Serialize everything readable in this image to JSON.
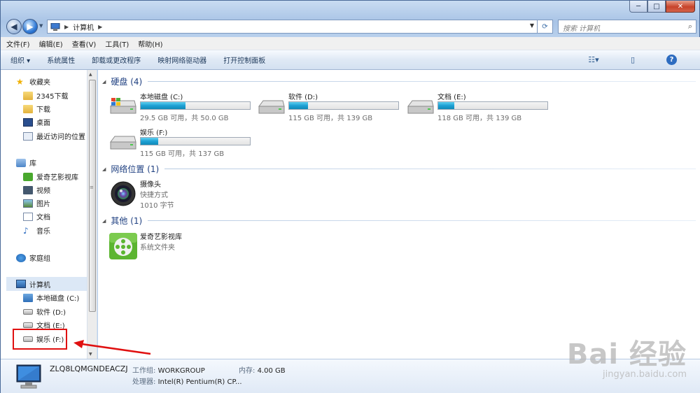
{
  "window": {
    "min_label": "─",
    "max_label": "□",
    "close_label": "✕"
  },
  "address": {
    "location": "计算机",
    "search_placeholder": "搜索 计算机"
  },
  "menu": [
    "文件(F)",
    "编辑(E)",
    "查看(V)",
    "工具(T)",
    "帮助(H)"
  ],
  "toolbar": {
    "organize": "组织 ▾",
    "system_properties": "系统属性",
    "uninstall": "卸载或更改程序",
    "map_drive": "映射网络驱动器",
    "control_panel": "打开控制面板"
  },
  "sidebar": {
    "favorites": "收藏夹",
    "fav_items": [
      "2345下载",
      "下载",
      "桌面",
      "最近访问的位置"
    ],
    "libraries": "库",
    "lib_items": [
      "爱奇艺影视库",
      "视频",
      "图片",
      "文档",
      "音乐"
    ],
    "homegroup": "家庭组",
    "computer": "计算机",
    "drives": [
      "本地磁盘 (C:)",
      "软件 (D:)",
      "文档 (E:)",
      "娱乐 (F:)"
    ]
  },
  "groups": {
    "hdd": "硬盘 (4)",
    "network": "网络位置 (1)",
    "other": "其他 (1)"
  },
  "drives": [
    {
      "name": "本地磁盘 (C:)",
      "status": "29.5 GB 可用，共 50.0 GB",
      "used_fraction": 0.41
    },
    {
      "name": "软件 (D:)",
      "status": "115 GB 可用，共 139 GB",
      "used_fraction": 0.17
    },
    {
      "name": "文档 (E:)",
      "status": "118 GB 可用，共 139 GB",
      "used_fraction": 0.15
    },
    {
      "name": "娱乐 (F:)",
      "status": "115 GB 可用，共 137 GB",
      "used_fraction": 0.16
    }
  ],
  "network_item": {
    "name": "摄像头",
    "type": "快捷方式",
    "size": "1010 字节"
  },
  "other_item": {
    "name": "爱奇艺影视库",
    "type": "系统文件夹"
  },
  "details": {
    "computer_name": "ZLQ8LQMGNDEACZJ",
    "workgroup_label": "工作组:",
    "workgroup": "WORKGROUP",
    "memory_label": "内存:",
    "memory": "4.00 GB",
    "cpu_label": "处理器:",
    "cpu": "Intel(R) Pentium(R) CP..."
  },
  "watermark": {
    "brand": "Bai 经验",
    "url": "jingyan.baidu.com"
  },
  "colors": {
    "annotation": "#e01010",
    "drive_fill": "#1ea0d4",
    "group_heading": "#1e3f80"
  }
}
